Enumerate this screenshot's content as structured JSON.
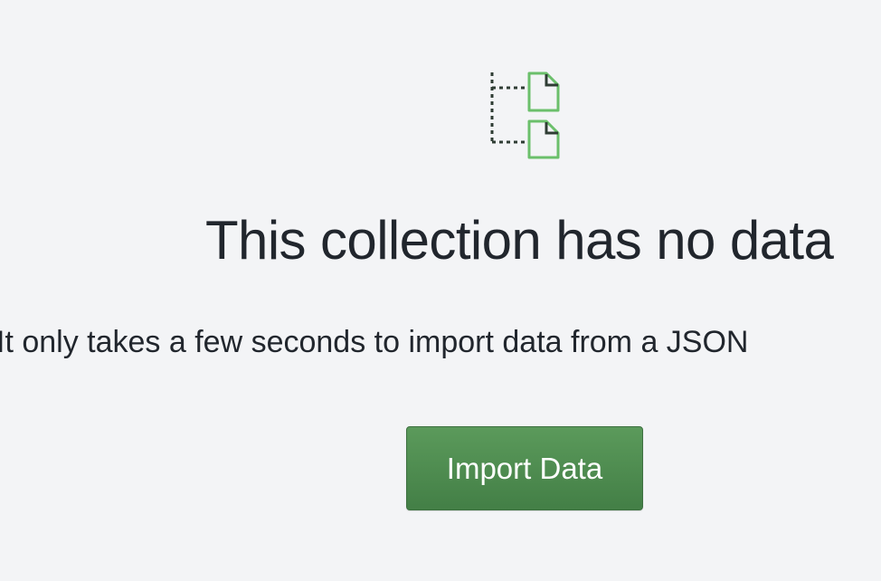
{
  "empty_state": {
    "icon": "collection-documents-icon",
    "title": "This collection has no data",
    "description": "It only takes a few seconds to import data from a JSON",
    "import_button_label": "Import Data"
  },
  "colors": {
    "background": "#f3f4f6",
    "text": "#21262d",
    "icon_green": "#6bbf6b",
    "icon_dark": "#2f3d34",
    "button_green": "#4f8d50"
  }
}
